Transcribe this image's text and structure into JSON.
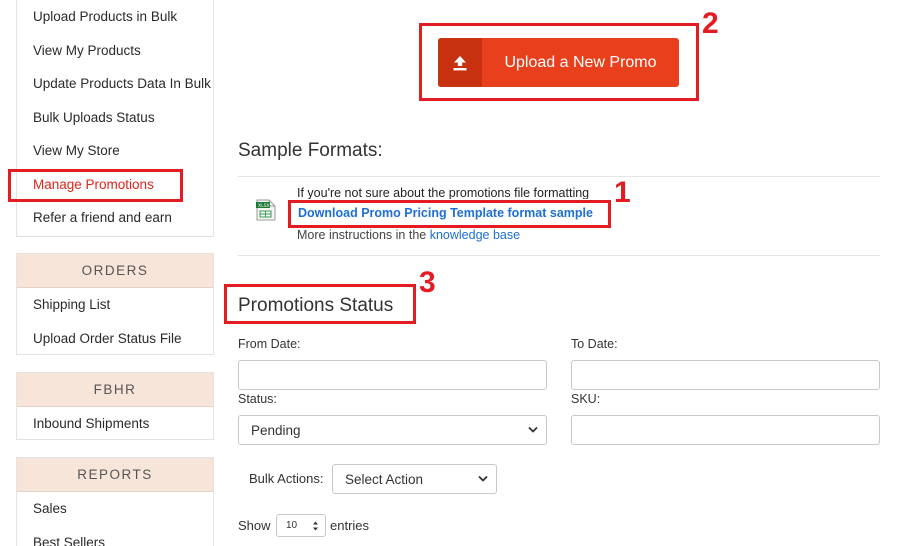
{
  "sidebar": {
    "panel1_items": [
      {
        "label": "Upload Products in Bulk"
      },
      {
        "label": "View My Products"
      },
      {
        "label": "Update Products Data In Bulk"
      },
      {
        "label": "Bulk Uploads Status"
      },
      {
        "label": "View My Store"
      },
      {
        "label": "Manage Promotions",
        "active": true
      },
      {
        "label": "Refer a friend and earn"
      }
    ],
    "orders": {
      "heading": "ORDERS",
      "items": [
        "Shipping List",
        "Upload Order Status File"
      ]
    },
    "fbhr": {
      "heading": "FBHR",
      "items": [
        "Inbound Shipments"
      ]
    },
    "reports": {
      "heading": "REPORTS",
      "items": [
        "Sales",
        "Best Sellers"
      ]
    }
  },
  "annotations": {
    "one": "1",
    "two": "2",
    "three": "3",
    "color": "#e31b23"
  },
  "upload": {
    "label": "Upload a New Promo",
    "icon": "upload-icon",
    "color": "#e8401c"
  },
  "sample": {
    "heading": "Sample Formats:",
    "intro": "If you're not sure about the promotions file formatting",
    "link": "Download Promo Pricing Template format sample",
    "more": "More instructions in the ",
    "kb_link": "knowledge base",
    "file_icon": "xlsx-file-icon",
    "file_icon_text": "XLSX"
  },
  "status": {
    "heading": "Promotions Status",
    "from_label": "From Date:",
    "to_label": "To Date:",
    "status_label": "Status:",
    "status_value": "Pending",
    "sku_label": "SKU:",
    "bulk_label": "Bulk Actions:",
    "bulk_value": "Select Action",
    "show_label": "Show",
    "show_value": "10",
    "entries_label": "entries"
  }
}
